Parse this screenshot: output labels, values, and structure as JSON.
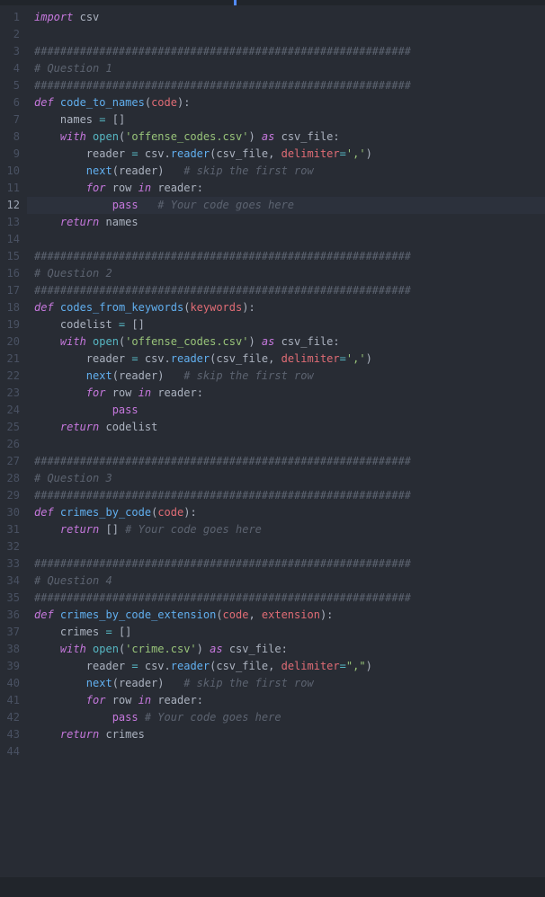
{
  "editor": {
    "highlighted_line": 12,
    "total_lines": 44,
    "tokens": {
      "import": "import",
      "def": "def",
      "with": "with",
      "as": "as",
      "for": "for",
      "in": "in",
      "return": "return",
      "pass": "pass",
      "csv": "csv",
      "code_to_names": "code_to_names",
      "codes_from_keywords": "codes_from_keywords",
      "crimes_by_code": "crimes_by_code",
      "crimes_by_code_extension": "crimes_by_code_extension",
      "code": "code",
      "keywords": "keywords",
      "extension": "extension",
      "names": "names",
      "codelist": "codelist",
      "crimes": "crimes",
      "open": "open",
      "csv_file": "csv_file",
      "reader": "reader",
      "next": "next",
      "row": "row",
      "delimiter": "delimiter",
      "offense_codes_csv": "'offense_codes.csv'",
      "crime_csv": "'crime.csv'",
      "comma_sq": "','",
      "comma_dq": "\",\"",
      "hash_bar": "##########################################################",
      "q1": "# Question 1",
      "q2": "# Question 2",
      "q3": "# Question 3",
      "q4": "# Question 4",
      "skip_first_row": "# skip the first row",
      "your_code_here": "# Your code goes here",
      "lbracket": "[",
      "rbracket": "]",
      "lparen": "(",
      "rparen": ")",
      "colon": ":",
      "comma_sp": ", ",
      "eq": "=",
      "eq_sp": " = ",
      "dot": "."
    }
  },
  "colors": {
    "background": "#282c34",
    "gutter_fg": "#495162",
    "accent": "#528bff",
    "highlight_bg": "#2c313c",
    "statusbar_bg": "#21252b"
  }
}
